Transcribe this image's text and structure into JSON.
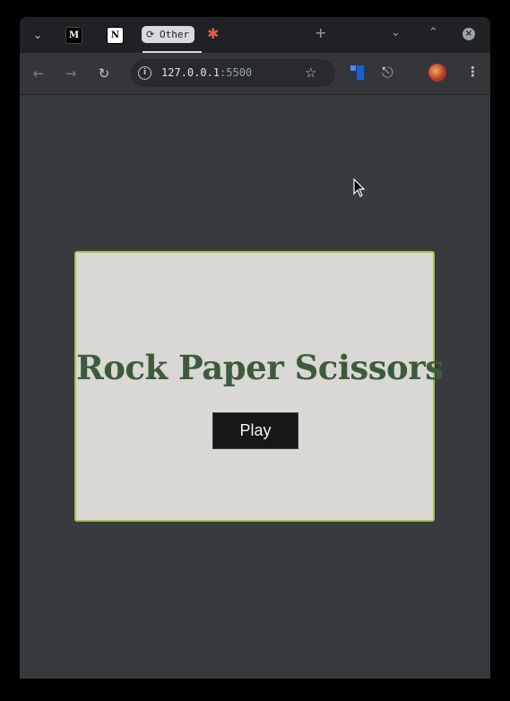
{
  "browser": {
    "tabs": {
      "group_label": "Other",
      "fav_m_letter": "M",
      "fav_n_letter": "N"
    },
    "address_bar": {
      "host": "127.0.0.1",
      "port": ":5500"
    }
  },
  "page": {
    "title": "Rock Paper Scissors",
    "play_button": "Play"
  },
  "colors": {
    "page_background": "#373b3f",
    "card_background": "#d9d8d5",
    "card_border": "#a9c14a",
    "title_color": "#3e5a3c",
    "button_background": "#171717"
  }
}
